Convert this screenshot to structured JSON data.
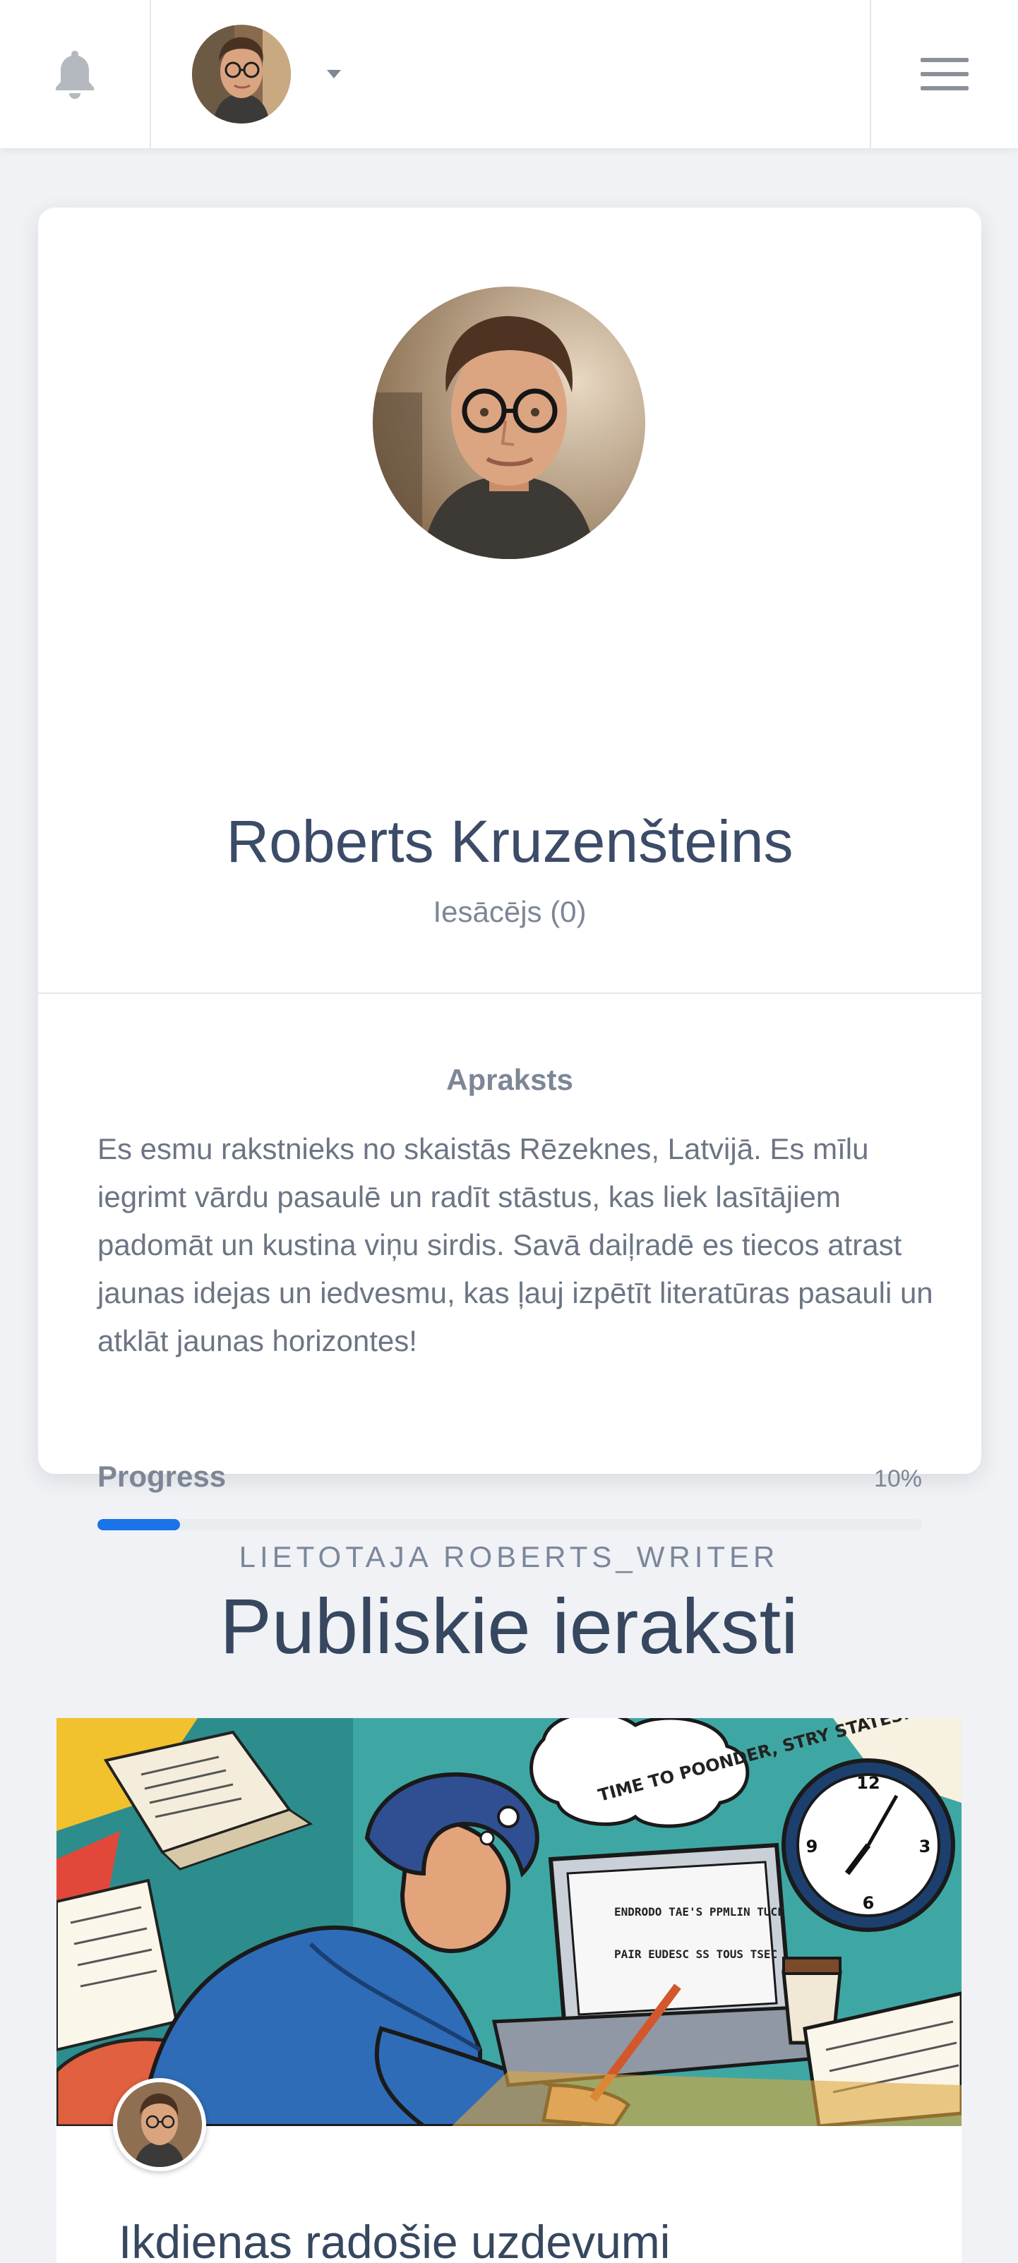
{
  "header": {
    "bell_icon": "bell-icon",
    "caret_icon": "caret-down-icon",
    "menu_icon": "hamburger-menu-icon"
  },
  "profile": {
    "name": "Roberts Kruzenšteins",
    "rank": "Iesācējs (0)",
    "description_title": "Apraksts",
    "description": "Es esmu rakstnieks no skaistās Rēzeknes, Latvijā. Es mīlu iegrimt vārdu pasaulē un radīt stāstus, kas liek lasītājiem padomāt un kustina viņu sirdis. Savā daiļradē es tiecos atrast jaunas idejas un iedvesmu, kas ļauj izpētīt literatūras pasauli un atklāt jaunas horizontes!",
    "progress_label": "Progress",
    "progress_value": "10%",
    "progress_fraction": 0.1
  },
  "section": {
    "subtitle": "LIETOTAJA ROBERTS_WRITER",
    "title": "Publiskie ieraksti"
  },
  "posts": [
    {
      "title": "Ikdienas radošie uzdevumi",
      "image_text": {
        "bubble": "TIME TO POONDER, STRY STATES.",
        "screen_line1": "ENDRODO TAE'S PPMLIN TUCE",
        "screen_line2": "PAIR EUDESC SS TOUS TSEC"
      }
    }
  ],
  "colors": {
    "accent": "#1a73e8",
    "heading": "#36475f",
    "muted": "#7d8696",
    "background": "#f0f2f5"
  }
}
